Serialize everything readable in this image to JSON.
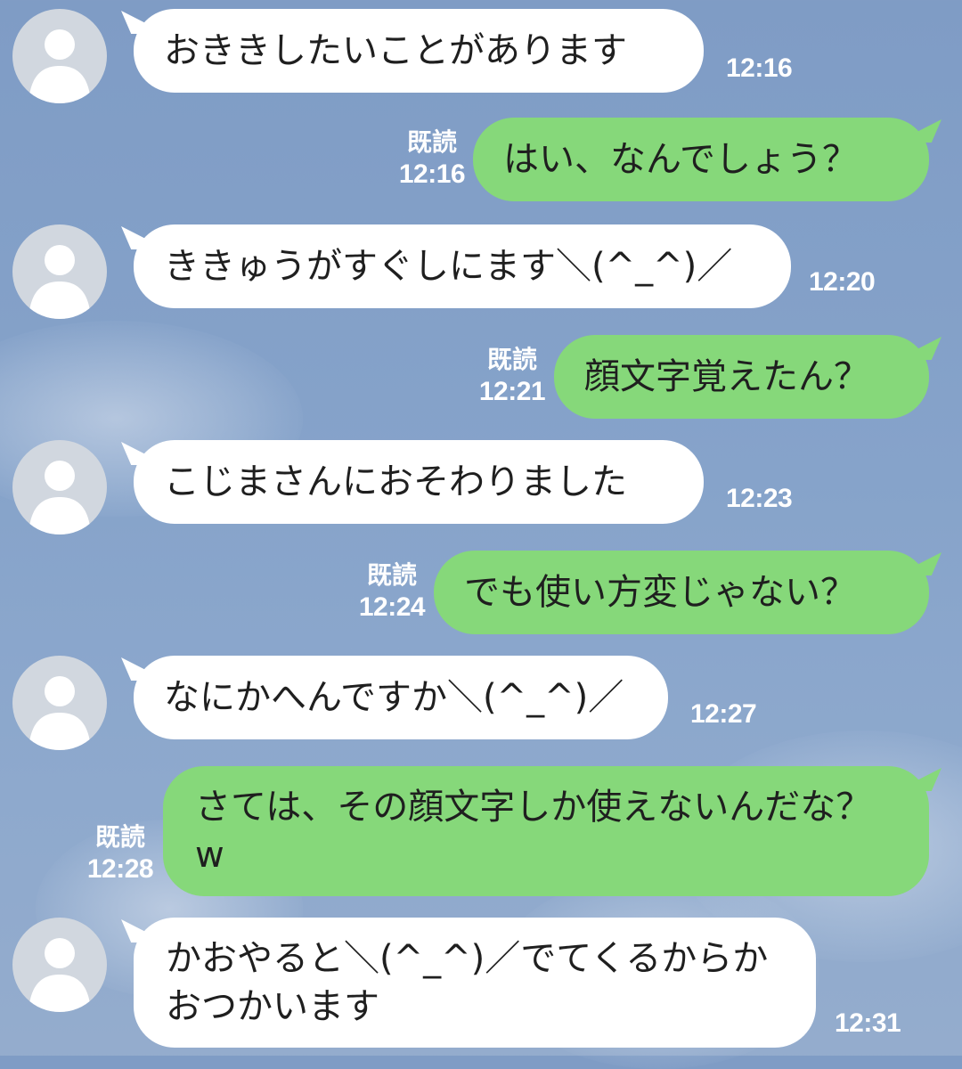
{
  "chat": {
    "read_label": "既読",
    "messages": [
      {
        "side": "in",
        "text": "おききしたいことがあります",
        "time": "12:16"
      },
      {
        "side": "out",
        "text": "はい、なんでしょう？",
        "time": "12:16"
      },
      {
        "side": "in",
        "text": "ききゅうがすぐしにます＼(^_^)／",
        "time": "12:20"
      },
      {
        "side": "out",
        "text": "顔文字覚えたん？",
        "time": "12:21"
      },
      {
        "side": "in",
        "text": "こじまさんにおそわりました",
        "time": "12:23"
      },
      {
        "side": "out",
        "text": "でも使い方変じゃない？",
        "time": "12:24"
      },
      {
        "side": "in",
        "text": "なにかへんですか＼(^_^)／",
        "time": "12:27"
      },
      {
        "side": "out",
        "text": "さては、その顔文字しか使えないんだな？w",
        "time": "12:28"
      },
      {
        "side": "in",
        "text": "かおやると＼(^_^)／でてくるからかおつかいます",
        "time": "12:31"
      }
    ]
  },
  "colors": {
    "incoming": "#ffffff",
    "outgoing": "#86d87a",
    "background": "#86a3ca"
  },
  "icons": {
    "avatar": "default-user-silhouette-icon"
  }
}
